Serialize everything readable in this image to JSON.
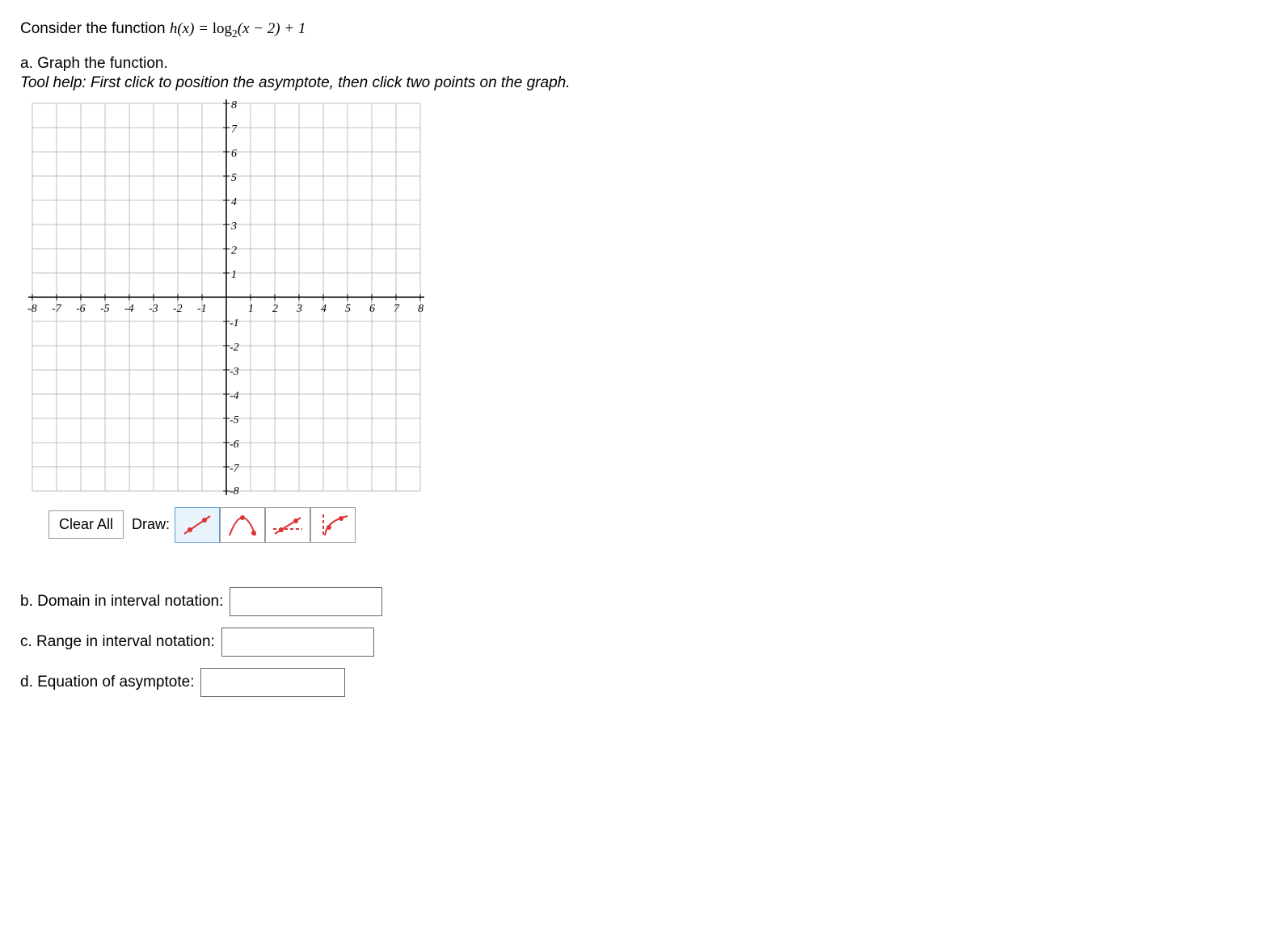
{
  "prompt": {
    "intro": "Consider the function ",
    "func_lhs": "h(x) = ",
    "log_word": "log",
    "log_base": "2",
    "func_rhs": "(x − 2) + 1"
  },
  "parts": {
    "a_label": "a. Graph the function.",
    "tool_help": "Tool help: First click to position the asymptote, then click two points on the graph.",
    "b_label": "b. Domain in interval notation:",
    "c_label": "c. Range in interval notation:",
    "d_label": "d. Equation of asymptote:"
  },
  "controls": {
    "clear_all": "Clear All",
    "draw_label": "Draw:"
  },
  "inputs": {
    "domain": "",
    "range": "",
    "asymptote": ""
  },
  "chart_data": {
    "type": "grid",
    "title": "",
    "xlabel": "",
    "ylabel": "",
    "x_ticks": [
      -8,
      -7,
      -6,
      -5,
      -4,
      -3,
      -2,
      -1,
      1,
      2,
      3,
      4,
      5,
      6,
      7,
      8
    ],
    "y_ticks": [
      -8,
      -7,
      -6,
      -5,
      -4,
      -3,
      -2,
      -1,
      1,
      2,
      3,
      4,
      5,
      6,
      7,
      8
    ],
    "xlim": [
      -8,
      8
    ],
    "ylim": [
      -8,
      8
    ],
    "series": []
  }
}
